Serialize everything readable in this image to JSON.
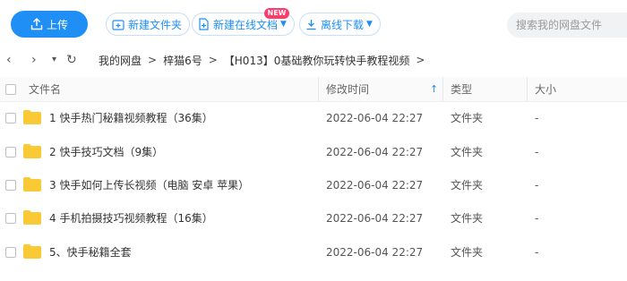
{
  "toolbar": {
    "upload_label": "上传",
    "new_folder_label": "新建文件夹",
    "new_online_doc_label": "新建在线文档",
    "new_badge": "NEW",
    "offline_download_label": "离线下载",
    "search_placeholder": "搜索我的网盘文件"
  },
  "nav": {
    "back": "‹",
    "forward": "›",
    "history": "▾",
    "refresh": "↻"
  },
  "breadcrumb": {
    "items": [
      "我的网盘",
      "梓猫6号",
      "【H013】0基础教你玩转快手教程视频"
    ],
    "separator": ">"
  },
  "table": {
    "columns": {
      "name": "文件名",
      "modified": "修改时间",
      "type": "类型",
      "size": "大小"
    },
    "sort_icon": "↑",
    "rows": [
      {
        "name": "1 快手热门秘籍视频教程（36集）",
        "modified": "2022-06-04 22:27",
        "type": "文件夹",
        "size": "-"
      },
      {
        "name": "2 快手技巧文档（9集）",
        "modified": "2022-06-04 22:27",
        "type": "文件夹",
        "size": "-"
      },
      {
        "name": "3 快手如何上传长视频（电脑 安卓 苹果）",
        "modified": "2022-06-04 22:27",
        "type": "文件夹",
        "size": "-"
      },
      {
        "name": "4 手机拍摄技巧视频教程（16集）",
        "modified": "2022-06-04 22:27",
        "type": "文件夹",
        "size": "-"
      },
      {
        "name": "5、快手秘籍全套",
        "modified": "2022-06-04 22:27",
        "type": "文件夹",
        "size": "-"
      }
    ]
  },
  "colors": {
    "accent": "#1f8ff5",
    "folder": "#f9c936",
    "badge": "#ff3b6b"
  }
}
